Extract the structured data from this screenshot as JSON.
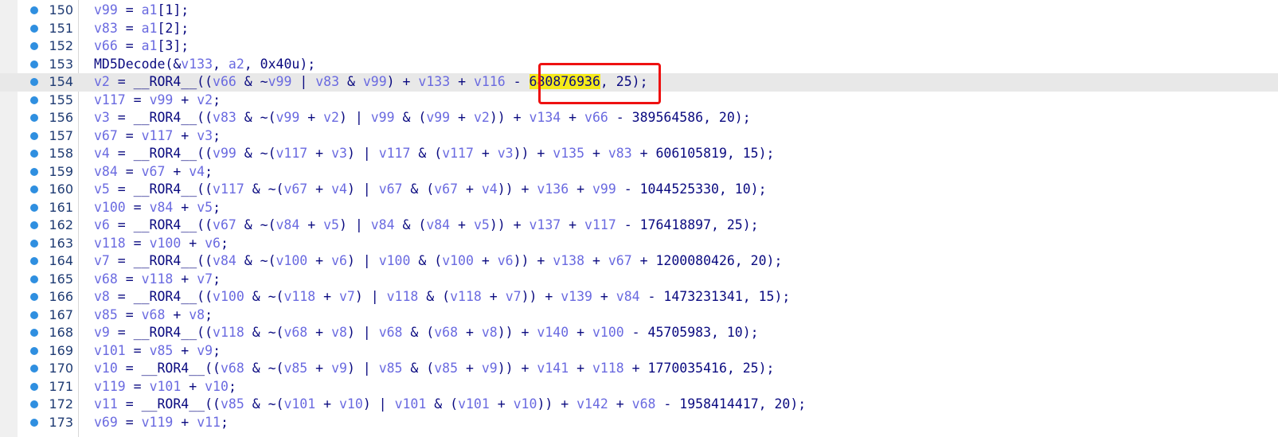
{
  "editor": {
    "lines": [
      {
        "n": "150",
        "tokens": [
          {
            "t": "v99",
            "c": "id"
          },
          {
            "t": " = "
          },
          {
            "t": "a1",
            "c": "id"
          },
          {
            "t": "[1];"
          }
        ]
      },
      {
        "n": "151",
        "tokens": [
          {
            "t": "v83",
            "c": "id"
          },
          {
            "t": " = "
          },
          {
            "t": "a1",
            "c": "id"
          },
          {
            "t": "[2];"
          }
        ]
      },
      {
        "n": "152",
        "tokens": [
          {
            "t": "v66",
            "c": "id"
          },
          {
            "t": " = "
          },
          {
            "t": "a1",
            "c": "id"
          },
          {
            "t": "[3];"
          }
        ]
      },
      {
        "n": "153",
        "tokens": [
          {
            "t": "MD5Decode(&"
          },
          {
            "t": "v133",
            "c": "id"
          },
          {
            "t": ", "
          },
          {
            "t": "a2",
            "c": "id"
          },
          {
            "t": ", 0x40u);"
          }
        ]
      },
      {
        "n": "154",
        "current": true,
        "tokens": [
          {
            "t": "v2",
            "c": "id"
          },
          {
            "t": " = __ROR4__(("
          },
          {
            "t": "v66",
            "c": "id"
          },
          {
            "t": " & ~"
          },
          {
            "t": "v99",
            "c": "id"
          },
          {
            "t": " | "
          },
          {
            "t": "v83",
            "c": "id"
          },
          {
            "t": " & "
          },
          {
            "t": "v99",
            "c": "id"
          },
          {
            "t": ") + "
          },
          {
            "t": "v133",
            "c": "id"
          },
          {
            "t": " + "
          },
          {
            "t": "v116",
            "c": "id"
          },
          {
            "t": " - "
          },
          {
            "t": "680876936",
            "c": "hl"
          },
          {
            "t": ", 25);"
          }
        ]
      },
      {
        "n": "155",
        "tokens": [
          {
            "t": "v117",
            "c": "id"
          },
          {
            "t": " = "
          },
          {
            "t": "v99",
            "c": "id"
          },
          {
            "t": " + "
          },
          {
            "t": "v2",
            "c": "id"
          },
          {
            "t": ";"
          }
        ]
      },
      {
        "n": "156",
        "tokens": [
          {
            "t": "v3",
            "c": "id"
          },
          {
            "t": " = __ROR4__(("
          },
          {
            "t": "v83",
            "c": "id"
          },
          {
            "t": " & ~("
          },
          {
            "t": "v99",
            "c": "id"
          },
          {
            "t": " + "
          },
          {
            "t": "v2",
            "c": "id"
          },
          {
            "t": ") | "
          },
          {
            "t": "v99",
            "c": "id"
          },
          {
            "t": " & ("
          },
          {
            "t": "v99",
            "c": "id"
          },
          {
            "t": " + "
          },
          {
            "t": "v2",
            "c": "id"
          },
          {
            "t": ")) + "
          },
          {
            "t": "v134",
            "c": "id"
          },
          {
            "t": " + "
          },
          {
            "t": "v66",
            "c": "id"
          },
          {
            "t": " - 389564586, 20);"
          }
        ]
      },
      {
        "n": "157",
        "tokens": [
          {
            "t": "v67",
            "c": "id"
          },
          {
            "t": " = "
          },
          {
            "t": "v117",
            "c": "id"
          },
          {
            "t": " + "
          },
          {
            "t": "v3",
            "c": "id"
          },
          {
            "t": ";"
          }
        ]
      },
      {
        "n": "158",
        "tokens": [
          {
            "t": "v4",
            "c": "id"
          },
          {
            "t": " = __ROR4__(("
          },
          {
            "t": "v99",
            "c": "id"
          },
          {
            "t": " & ~("
          },
          {
            "t": "v117",
            "c": "id"
          },
          {
            "t": " + "
          },
          {
            "t": "v3",
            "c": "id"
          },
          {
            "t": ") | "
          },
          {
            "t": "v117",
            "c": "id"
          },
          {
            "t": " & ("
          },
          {
            "t": "v117",
            "c": "id"
          },
          {
            "t": " + "
          },
          {
            "t": "v3",
            "c": "id"
          },
          {
            "t": ")) + "
          },
          {
            "t": "v135",
            "c": "id"
          },
          {
            "t": " + "
          },
          {
            "t": "v83",
            "c": "id"
          },
          {
            "t": " + 606105819, 15);"
          }
        ]
      },
      {
        "n": "159",
        "tokens": [
          {
            "t": "v84",
            "c": "id"
          },
          {
            "t": " = "
          },
          {
            "t": "v67",
            "c": "id"
          },
          {
            "t": " + "
          },
          {
            "t": "v4",
            "c": "id"
          },
          {
            "t": ";"
          }
        ]
      },
      {
        "n": "160",
        "tokens": [
          {
            "t": "v5",
            "c": "id"
          },
          {
            "t": " = __ROR4__(("
          },
          {
            "t": "v117",
            "c": "id"
          },
          {
            "t": " & ~("
          },
          {
            "t": "v67",
            "c": "id"
          },
          {
            "t": " + "
          },
          {
            "t": "v4",
            "c": "id"
          },
          {
            "t": ") | "
          },
          {
            "t": "v67",
            "c": "id"
          },
          {
            "t": " & ("
          },
          {
            "t": "v67",
            "c": "id"
          },
          {
            "t": " + "
          },
          {
            "t": "v4",
            "c": "id"
          },
          {
            "t": ")) + "
          },
          {
            "t": "v136",
            "c": "id"
          },
          {
            "t": " + "
          },
          {
            "t": "v99",
            "c": "id"
          },
          {
            "t": " - 1044525330, 10);"
          }
        ]
      },
      {
        "n": "161",
        "tokens": [
          {
            "t": "v100",
            "c": "id"
          },
          {
            "t": " = "
          },
          {
            "t": "v84",
            "c": "id"
          },
          {
            "t": " + "
          },
          {
            "t": "v5",
            "c": "id"
          },
          {
            "t": ";"
          }
        ]
      },
      {
        "n": "162",
        "tokens": [
          {
            "t": "v6",
            "c": "id"
          },
          {
            "t": " = __ROR4__(("
          },
          {
            "t": "v67",
            "c": "id"
          },
          {
            "t": " & ~("
          },
          {
            "t": "v84",
            "c": "id"
          },
          {
            "t": " + "
          },
          {
            "t": "v5",
            "c": "id"
          },
          {
            "t": ") | "
          },
          {
            "t": "v84",
            "c": "id"
          },
          {
            "t": " & ("
          },
          {
            "t": "v84",
            "c": "id"
          },
          {
            "t": " + "
          },
          {
            "t": "v5",
            "c": "id"
          },
          {
            "t": ")) + "
          },
          {
            "t": "v137",
            "c": "id"
          },
          {
            "t": " + "
          },
          {
            "t": "v117",
            "c": "id"
          },
          {
            "t": " - 176418897, 25);"
          }
        ]
      },
      {
        "n": "163",
        "tokens": [
          {
            "t": "v118",
            "c": "id"
          },
          {
            "t": " = "
          },
          {
            "t": "v100",
            "c": "id"
          },
          {
            "t": " + "
          },
          {
            "t": "v6",
            "c": "id"
          },
          {
            "t": ";"
          }
        ]
      },
      {
        "n": "164",
        "tokens": [
          {
            "t": "v7",
            "c": "id"
          },
          {
            "t": " = __ROR4__(("
          },
          {
            "t": "v84",
            "c": "id"
          },
          {
            "t": " & ~("
          },
          {
            "t": "v100",
            "c": "id"
          },
          {
            "t": " + "
          },
          {
            "t": "v6",
            "c": "id"
          },
          {
            "t": ") | "
          },
          {
            "t": "v100",
            "c": "id"
          },
          {
            "t": " & ("
          },
          {
            "t": "v100",
            "c": "id"
          },
          {
            "t": " + "
          },
          {
            "t": "v6",
            "c": "id"
          },
          {
            "t": ")) + "
          },
          {
            "t": "v138",
            "c": "id"
          },
          {
            "t": " + "
          },
          {
            "t": "v67",
            "c": "id"
          },
          {
            "t": " + 1200080426, 20);"
          }
        ]
      },
      {
        "n": "165",
        "tokens": [
          {
            "t": "v68",
            "c": "id"
          },
          {
            "t": " = "
          },
          {
            "t": "v118",
            "c": "id"
          },
          {
            "t": " + "
          },
          {
            "t": "v7",
            "c": "id"
          },
          {
            "t": ";"
          }
        ]
      },
      {
        "n": "166",
        "tokens": [
          {
            "t": "v8",
            "c": "id"
          },
          {
            "t": " = __ROR4__(("
          },
          {
            "t": "v100",
            "c": "id"
          },
          {
            "t": " & ~("
          },
          {
            "t": "v118",
            "c": "id"
          },
          {
            "t": " + "
          },
          {
            "t": "v7",
            "c": "id"
          },
          {
            "t": ") | "
          },
          {
            "t": "v118",
            "c": "id"
          },
          {
            "t": " & ("
          },
          {
            "t": "v118",
            "c": "id"
          },
          {
            "t": " + "
          },
          {
            "t": "v7",
            "c": "id"
          },
          {
            "t": ")) + "
          },
          {
            "t": "v139",
            "c": "id"
          },
          {
            "t": " + "
          },
          {
            "t": "v84",
            "c": "id"
          },
          {
            "t": " - 1473231341, 15);"
          }
        ]
      },
      {
        "n": "167",
        "tokens": [
          {
            "t": "v85",
            "c": "id"
          },
          {
            "t": " = "
          },
          {
            "t": "v68",
            "c": "id"
          },
          {
            "t": " + "
          },
          {
            "t": "v8",
            "c": "id"
          },
          {
            "t": ";"
          }
        ]
      },
      {
        "n": "168",
        "tokens": [
          {
            "t": "v9",
            "c": "id"
          },
          {
            "t": " = __ROR4__(("
          },
          {
            "t": "v118",
            "c": "id"
          },
          {
            "t": " & ~("
          },
          {
            "t": "v68",
            "c": "id"
          },
          {
            "t": " + "
          },
          {
            "t": "v8",
            "c": "id"
          },
          {
            "t": ") | "
          },
          {
            "t": "v68",
            "c": "id"
          },
          {
            "t": " & ("
          },
          {
            "t": "v68",
            "c": "id"
          },
          {
            "t": " + "
          },
          {
            "t": "v8",
            "c": "id"
          },
          {
            "t": ")) + "
          },
          {
            "t": "v140",
            "c": "id"
          },
          {
            "t": " + "
          },
          {
            "t": "v100",
            "c": "id"
          },
          {
            "t": " - 45705983, 10);"
          }
        ]
      },
      {
        "n": "169",
        "tokens": [
          {
            "t": "v101",
            "c": "id"
          },
          {
            "t": " = "
          },
          {
            "t": "v85",
            "c": "id"
          },
          {
            "t": " + "
          },
          {
            "t": "v9",
            "c": "id"
          },
          {
            "t": ";"
          }
        ]
      },
      {
        "n": "170",
        "tokens": [
          {
            "t": "v10",
            "c": "id"
          },
          {
            "t": " = __ROR4__(("
          },
          {
            "t": "v68",
            "c": "id"
          },
          {
            "t": " & ~("
          },
          {
            "t": "v85",
            "c": "id"
          },
          {
            "t": " + "
          },
          {
            "t": "v9",
            "c": "id"
          },
          {
            "t": ") | "
          },
          {
            "t": "v85",
            "c": "id"
          },
          {
            "t": " & ("
          },
          {
            "t": "v85",
            "c": "id"
          },
          {
            "t": " + "
          },
          {
            "t": "v9",
            "c": "id"
          },
          {
            "t": ")) + "
          },
          {
            "t": "v141",
            "c": "id"
          },
          {
            "t": " + "
          },
          {
            "t": "v118",
            "c": "id"
          },
          {
            "t": " + 1770035416, 25);"
          }
        ]
      },
      {
        "n": "171",
        "tokens": [
          {
            "t": "v119",
            "c": "id"
          },
          {
            "t": " = "
          },
          {
            "t": "v101",
            "c": "id"
          },
          {
            "t": " + "
          },
          {
            "t": "v10",
            "c": "id"
          },
          {
            "t": ";"
          }
        ]
      },
      {
        "n": "172",
        "tokens": [
          {
            "t": "v11",
            "c": "id"
          },
          {
            "t": " = __ROR4__(("
          },
          {
            "t": "v85",
            "c": "id"
          },
          {
            "t": " & ~("
          },
          {
            "t": "v101",
            "c": "id"
          },
          {
            "t": " + "
          },
          {
            "t": "v10",
            "c": "id"
          },
          {
            "t": ") | "
          },
          {
            "t": "v101",
            "c": "id"
          },
          {
            "t": " & ("
          },
          {
            "t": "v101",
            "c": "id"
          },
          {
            "t": " + "
          },
          {
            "t": "v10",
            "c": "id"
          },
          {
            "t": ")) + "
          },
          {
            "t": "v142",
            "c": "id"
          },
          {
            "t": " + "
          },
          {
            "t": "v68",
            "c": "id"
          },
          {
            "t": " - 1958414417, 20);"
          }
        ]
      },
      {
        "n": "173",
        "tokens": [
          {
            "t": "v69",
            "c": "id"
          },
          {
            "t": " = "
          },
          {
            "t": "v119",
            "c": "id"
          },
          {
            "t": " + "
          },
          {
            "t": "v11",
            "c": "id"
          },
          {
            "t": ";"
          }
        ]
      }
    ]
  },
  "colors": {
    "keyword": "#0a0a80",
    "identifier": "#6a6ae0",
    "highlight": "#f5ea1a",
    "callout": "#ee1111",
    "breakpoint": "#2f8fe0",
    "current_line": "#e8e8e8"
  }
}
